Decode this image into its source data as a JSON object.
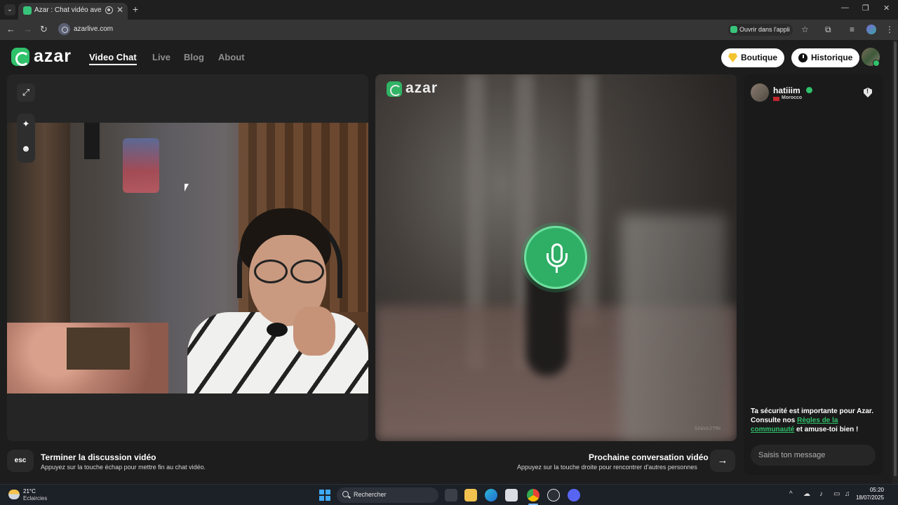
{
  "browser": {
    "tab_title": "Azar : Chat vidéo avec de n",
    "tab_close": "✕",
    "new_tab": "+",
    "url": "azarlive.com",
    "open_in_app": "Ouvrir dans l'appli",
    "icons": [
      "back-icon",
      "forward-icon",
      "reload-icon",
      "star-icon",
      "extensions-icon",
      "cast-icon",
      "menu-icon"
    ]
  },
  "app": {
    "logo": "azar",
    "nav": [
      {
        "label": "Video Chat",
        "active": true
      },
      {
        "label": "Live",
        "active": false
      },
      {
        "label": "Blog",
        "active": false
      },
      {
        "label": "About",
        "active": false
      }
    ],
    "boutique_label": "Boutique",
    "historique_label": "Historique",
    "accent_color": "#30c16b"
  },
  "left_panel": {
    "tools": [
      "expand-icon",
      "effects-sparkle-icon",
      "face-filter-icon"
    ]
  },
  "right_panel": {
    "logo": "azar",
    "watermark": "SkWxk2TMk",
    "state": "mic-active"
  },
  "chat": {
    "peer_name": "hatiiim",
    "peer_country": "Morocco",
    "safety_prefix": "Ta sécurité est importante pour Azar. Consulte nos ",
    "safety_link": "Règles de la communauté",
    "safety_suffix": " et amuse-toi bien !",
    "input_placeholder": "Saisis ton message"
  },
  "footer": {
    "esc_key": "esc",
    "end_title": "Terminer la discussion vidéo",
    "end_sub": "Appuyez sur la touche échap pour mettre fin au chat vidéo.",
    "next_title": "Prochaine conversation vidéo",
    "next_sub": "Appuyez sur la touche droite pour rencontrer d'autres personnes",
    "next_arrow": "→"
  },
  "taskbar": {
    "weather_temp": "21°C",
    "weather_desc": "Eclaircies",
    "search_label": "Rechercher",
    "time": "05:20",
    "date": "18/07/2025"
  }
}
